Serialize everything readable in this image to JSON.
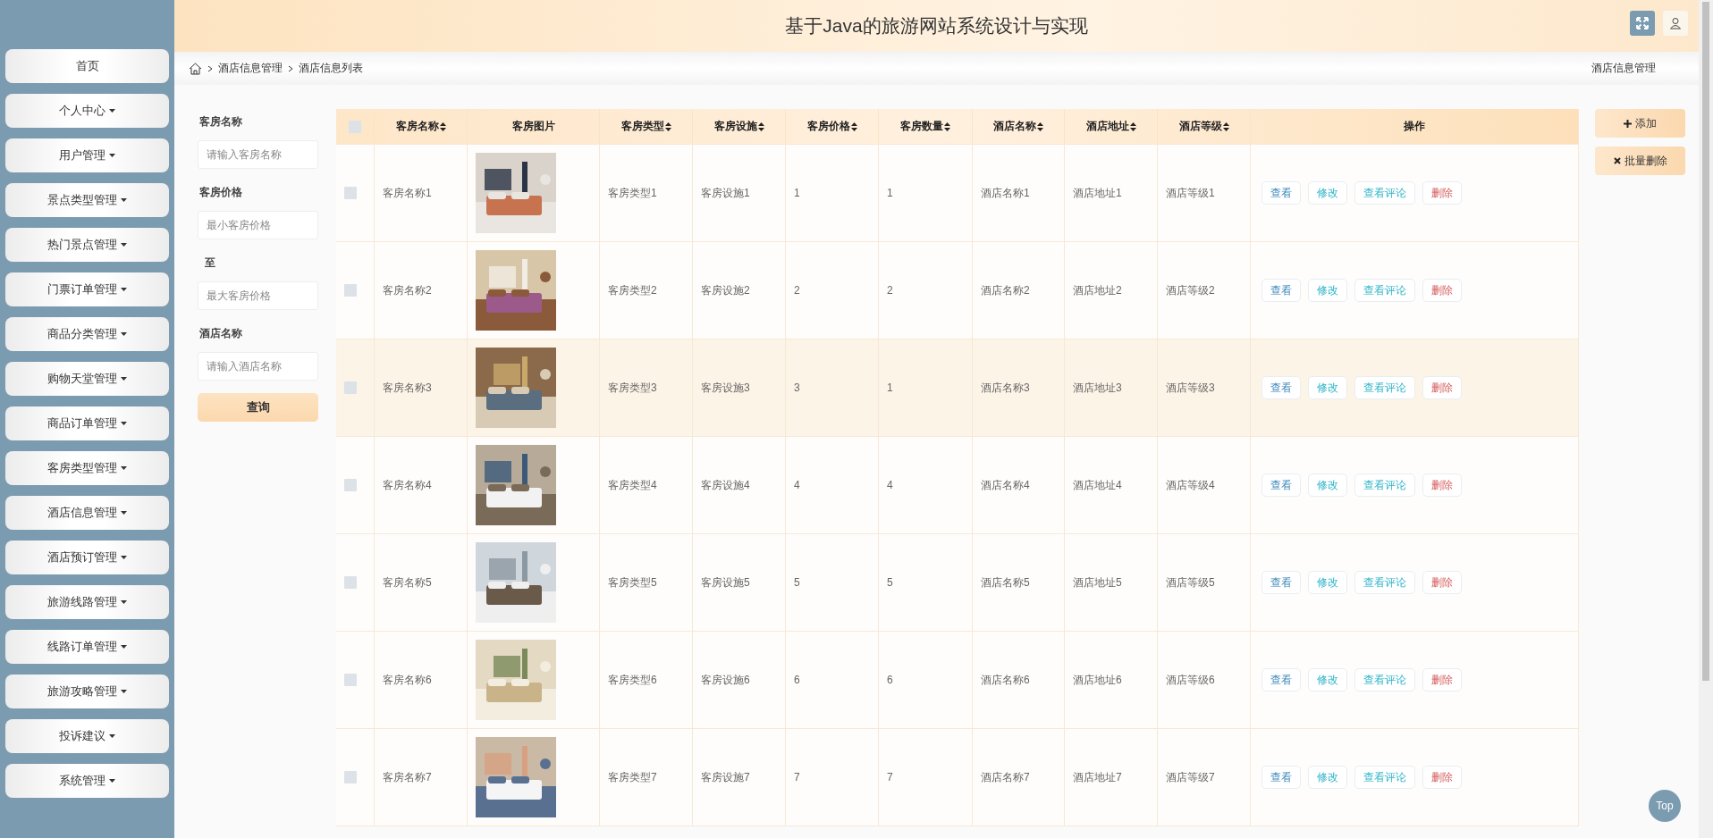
{
  "header": {
    "title": "基于Java的旅游网站系统设计与实现"
  },
  "sidebar": {
    "items": [
      {
        "label": "首页",
        "has_menu": false
      },
      {
        "label": "个人中心",
        "has_menu": true
      },
      {
        "label": "用户管理",
        "has_menu": true
      },
      {
        "label": "景点类型管理",
        "has_menu": true
      },
      {
        "label": "热门景点管理",
        "has_menu": true
      },
      {
        "label": "门票订单管理",
        "has_menu": true
      },
      {
        "label": "商品分类管理",
        "has_menu": true
      },
      {
        "label": "购物天堂管理",
        "has_menu": true
      },
      {
        "label": "商品订单管理",
        "has_menu": true
      },
      {
        "label": "客房类型管理",
        "has_menu": true
      },
      {
        "label": "酒店信息管理",
        "has_menu": true
      },
      {
        "label": "酒店预订管理",
        "has_menu": true
      },
      {
        "label": "旅游线路管理",
        "has_menu": true
      },
      {
        "label": "线路订单管理",
        "has_menu": true
      },
      {
        "label": "旅游攻略管理",
        "has_menu": true
      },
      {
        "label": "投诉建议",
        "has_menu": true
      },
      {
        "label": "系统管理",
        "has_menu": true
      }
    ]
  },
  "breadcrumb": {
    "items": [
      "酒店信息管理",
      "酒店信息列表"
    ],
    "section": "酒店信息管理"
  },
  "filters": [
    {
      "kind": "label",
      "text": "客房名称"
    },
    {
      "kind": "input",
      "placeholder": "请输入客房名称"
    },
    {
      "kind": "label",
      "text": "客房价格"
    },
    {
      "kind": "input",
      "placeholder": "最小客房价格"
    },
    {
      "kind": "separator",
      "text": "至"
    },
    {
      "kind": "input",
      "placeholder": "最大客房价格"
    },
    {
      "kind": "label",
      "text": "酒店名称"
    },
    {
      "kind": "input",
      "placeholder": "请输入酒店名称"
    },
    {
      "kind": "button",
      "text": "查询"
    }
  ],
  "toolbar": [
    {
      "kind": "add",
      "label": "添加"
    },
    {
      "kind": "remove",
      "label": "批量删除"
    }
  ],
  "table": {
    "select_all": {
      "checked": false
    },
    "columns": [
      {
        "label": "客房名称",
        "sortable": true
      },
      {
        "label": "客房图片",
        "sortable": false
      },
      {
        "label": "客房类型",
        "sortable": true
      },
      {
        "label": "客房设施",
        "sortable": true
      },
      {
        "label": "客房价格",
        "sortable": true
      },
      {
        "label": "客房数量",
        "sortable": true
      },
      {
        "label": "酒店名称",
        "sortable": true
      },
      {
        "label": "酒店地址",
        "sortable": true
      },
      {
        "label": "酒店等级",
        "sortable": true
      },
      {
        "label": "操作",
        "sortable": false
      }
    ],
    "rows": [
      {
        "checked": false,
        "hovered": false,
        "name": "客房名称1",
        "type": "客房类型1",
        "facility": "客房设施1",
        "price": "1",
        "quantity": "1",
        "hotel_name": "酒店名称1",
        "hotel_address": "酒店地址1",
        "hotel_level": "酒店等级1",
        "actions": [
          {
            "kind": "view",
            "label": "查看"
          },
          {
            "kind": "edit",
            "label": "修改"
          },
          {
            "kind": "comments",
            "label": "查看评论"
          },
          {
            "kind": "delete",
            "label": "删除"
          }
        ]
      },
      {
        "checked": false,
        "hovered": false,
        "name": "客房名称2",
        "type": "客房类型2",
        "facility": "客房设施2",
        "price": "2",
        "quantity": "2",
        "hotel_name": "酒店名称2",
        "hotel_address": "酒店地址2",
        "hotel_level": "酒店等级2",
        "actions": [
          {
            "kind": "view",
            "label": "查看"
          },
          {
            "kind": "edit",
            "label": "修改"
          },
          {
            "kind": "comments",
            "label": "查看评论"
          },
          {
            "kind": "delete",
            "label": "删除"
          }
        ]
      },
      {
        "checked": false,
        "hovered": true,
        "name": "客房名称3",
        "type": "客房类型3",
        "facility": "客房设施3",
        "price": "3",
        "quantity": "1",
        "hotel_name": "酒店名称3",
        "hotel_address": "酒店地址3",
        "hotel_level": "酒店等级3",
        "actions": [
          {
            "kind": "view",
            "label": "查看"
          },
          {
            "kind": "edit",
            "label": "修改"
          },
          {
            "kind": "comments",
            "label": "查看评论"
          },
          {
            "kind": "delete",
            "label": "删除"
          }
        ]
      },
      {
        "checked": false,
        "hovered": false,
        "name": "客房名称4",
        "type": "客房类型4",
        "facility": "客房设施4",
        "price": "4",
        "quantity": "4",
        "hotel_name": "酒店名称4",
        "hotel_address": "酒店地址4",
        "hotel_level": "酒店等级4",
        "actions": [
          {
            "kind": "view",
            "label": "查看"
          },
          {
            "kind": "edit",
            "label": "修改"
          },
          {
            "kind": "comments",
            "label": "查看评论"
          },
          {
            "kind": "delete",
            "label": "删除"
          }
        ]
      },
      {
        "checked": false,
        "hovered": false,
        "name": "客房名称5",
        "type": "客房类型5",
        "facility": "客房设施5",
        "price": "5",
        "quantity": "5",
        "hotel_name": "酒店名称5",
        "hotel_address": "酒店地址5",
        "hotel_level": "酒店等级5",
        "actions": [
          {
            "kind": "view",
            "label": "查看"
          },
          {
            "kind": "edit",
            "label": "修改"
          },
          {
            "kind": "comments",
            "label": "查看评论"
          },
          {
            "kind": "delete",
            "label": "删除"
          }
        ]
      },
      {
        "checked": false,
        "hovered": false,
        "name": "客房名称6",
        "type": "客房类型6",
        "facility": "客房设施6",
        "price": "6",
        "quantity": "6",
        "hotel_name": "酒店名称6",
        "hotel_address": "酒店地址6",
        "hotel_level": "酒店等级6",
        "actions": [
          {
            "kind": "view",
            "label": "查看"
          },
          {
            "kind": "edit",
            "label": "修改"
          },
          {
            "kind": "comments",
            "label": "查看评论"
          },
          {
            "kind": "delete",
            "label": "删除"
          }
        ]
      },
      {
        "checked": false,
        "hovered": false,
        "name": "客房名称7",
        "type": "客房类型7",
        "facility": "客房设施7",
        "price": "7",
        "quantity": "7",
        "hotel_name": "酒店名称7",
        "hotel_address": "酒店地址7",
        "hotel_level": "酒店等级7",
        "actions": [
          {
            "kind": "view",
            "label": "查看"
          },
          {
            "kind": "edit",
            "label": "修改"
          },
          {
            "kind": "comments",
            "label": "查看评论"
          },
          {
            "kind": "delete",
            "label": "删除"
          }
        ]
      }
    ]
  },
  "back_to_top": "Top"
}
